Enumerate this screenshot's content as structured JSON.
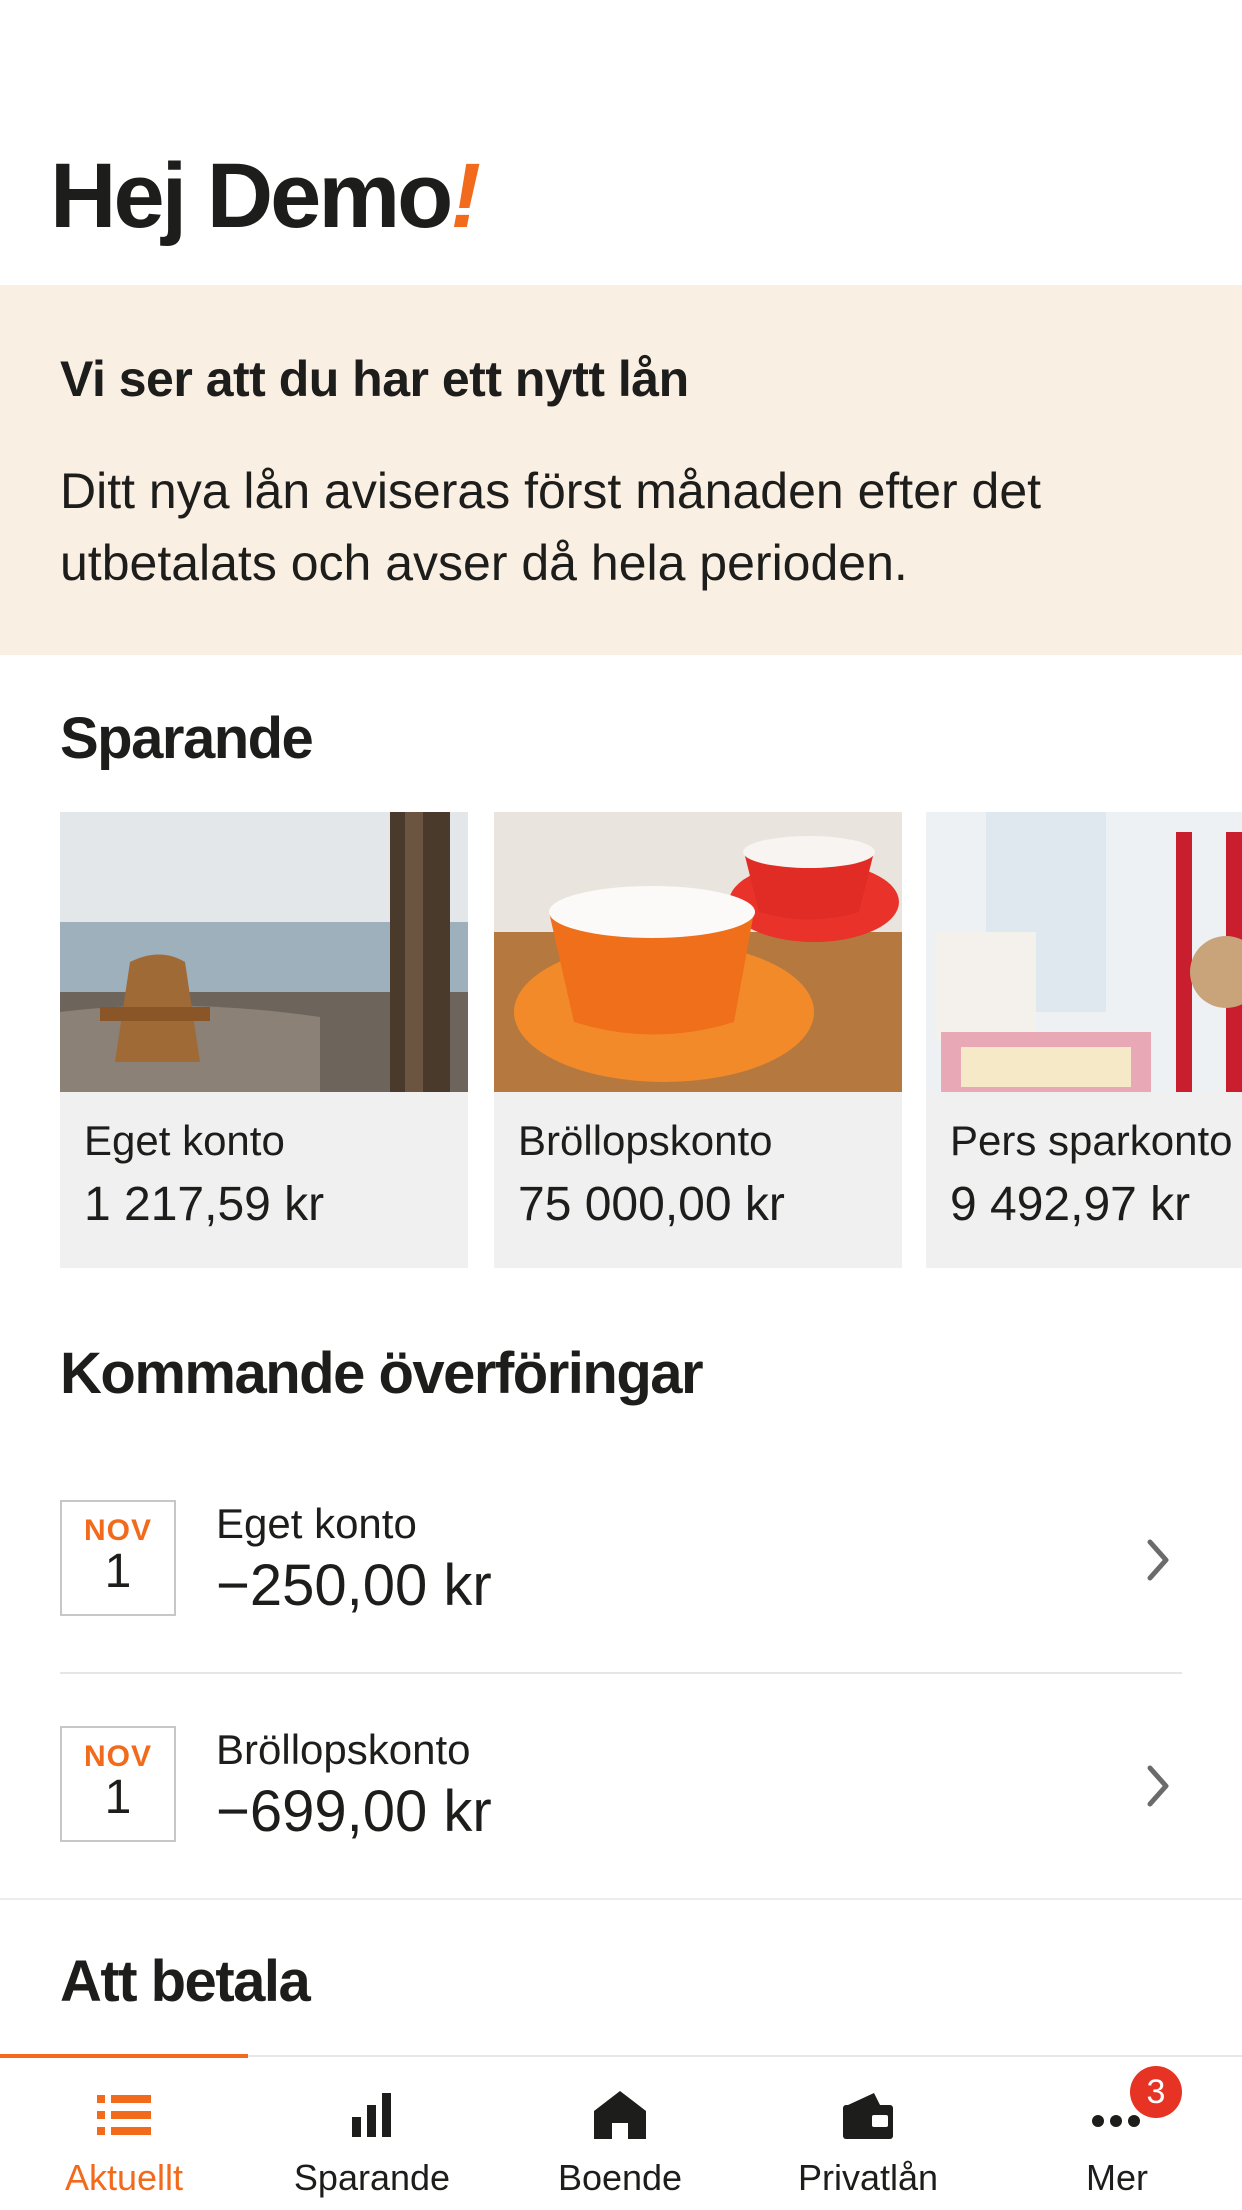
{
  "header": {
    "greeting": "Hej Demo",
    "greeting_mark": "!"
  },
  "notice": {
    "title": "Vi ser att du har ett nytt lån",
    "body": "Ditt nya lån aviseras först månaden efter det utbetalats och avser då hela perioden."
  },
  "savings": {
    "title": "Sparande",
    "accounts": [
      {
        "name": "Eget konto",
        "amount": "1 217,59 kr"
      },
      {
        "name": "Bröllopskonto",
        "amount": "75 000,00 kr"
      },
      {
        "name": "Pers sparkonto",
        "amount": "9 492,97 kr"
      }
    ]
  },
  "transfers": {
    "title": "Kommande överföringar",
    "items": [
      {
        "month": "NOV",
        "day": "1",
        "account": "Eget konto",
        "amount": "−250,00 kr"
      },
      {
        "month": "NOV",
        "day": "1",
        "account": "Bröllopskonto",
        "amount": "−699,00 kr"
      }
    ]
  },
  "payments": {
    "title": "Att betala"
  },
  "tabbar": {
    "tabs": [
      {
        "label": "Aktuellt",
        "icon": "list-icon",
        "active": true
      },
      {
        "label": "Sparande",
        "icon": "bar-chart-icon",
        "active": false
      },
      {
        "label": "Boende",
        "icon": "home-icon",
        "active": false
      },
      {
        "label": "Privatlån",
        "icon": "wallet-icon",
        "active": false
      },
      {
        "label": "Mer",
        "icon": "more-icon",
        "active": false
      }
    ],
    "badge_count": "3"
  },
  "colors": {
    "accent": "#f26b1d",
    "notice_bg": "#faefe3",
    "badge": "#e63323",
    "text": "#1d1d1b"
  }
}
